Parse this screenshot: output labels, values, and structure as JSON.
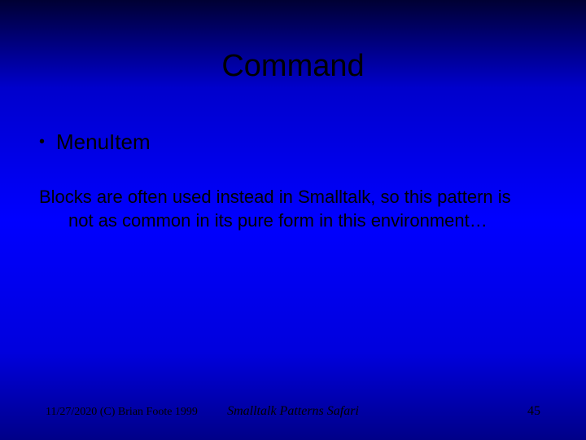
{
  "slide": {
    "title": "Command",
    "bullets": [
      "MenuItem"
    ],
    "body": "Blocks are often used instead in Smalltalk, so this pattern is not as common in its pure form in this environment…"
  },
  "footer": {
    "date": "11/27/2020",
    "copyright": "(C) Brian Foote 1999",
    "center": "Smalltalk Patterns Safari",
    "page": "45"
  }
}
